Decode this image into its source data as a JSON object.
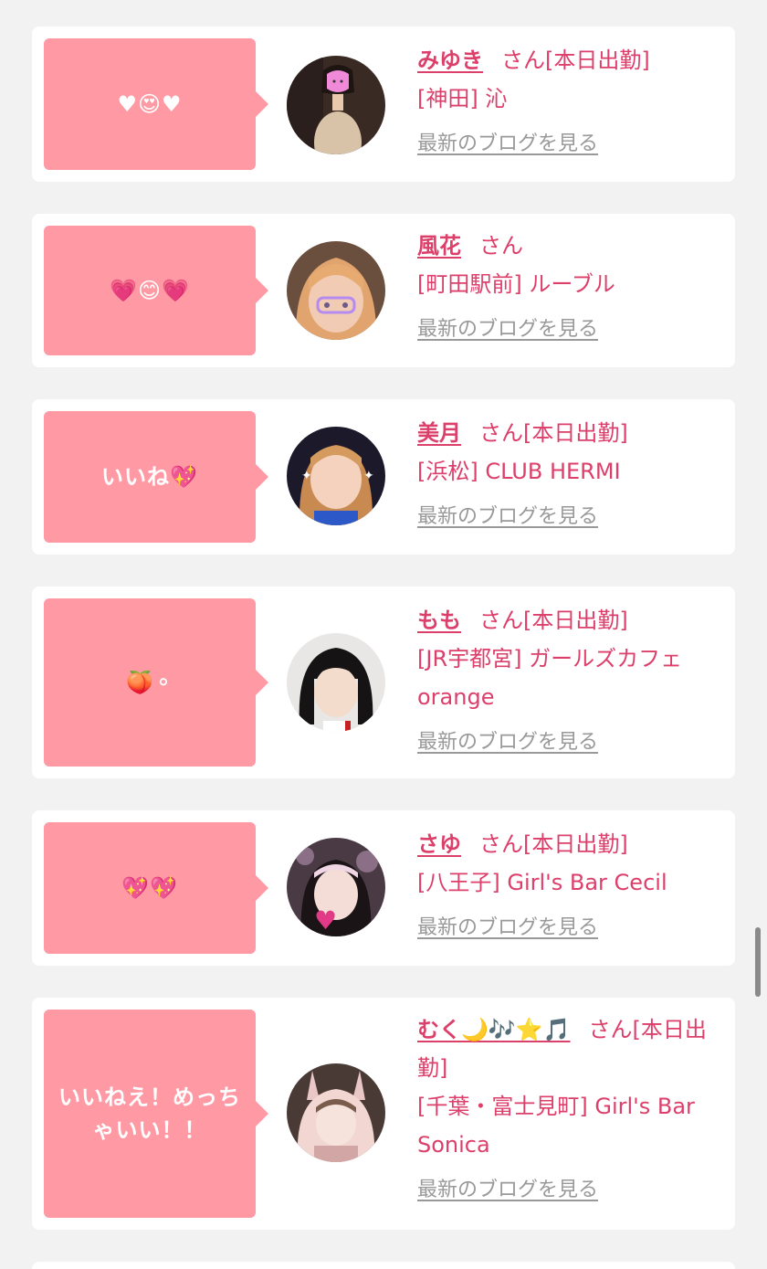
{
  "feed": {
    "items": [
      {
        "message": "♥😍♥",
        "name": "みゆき",
        "honorific": "さん",
        "status": "[本日出勤]",
        "location": "[神田] 沁",
        "blog_link": "最新のブログを見る"
      },
      {
        "message": "💗😊💗",
        "name": "風花",
        "honorific": "さん",
        "status": "",
        "location": "[町田駅前] ルーブル",
        "blog_link": "最新のブログを見る"
      },
      {
        "message": "いいね💖",
        "name": "美月",
        "honorific": "さん",
        "status": "[本日出勤]",
        "location": "[浜松] CLUB HERMI",
        "blog_link": "最新のブログを見る"
      },
      {
        "message": "🍑⚬",
        "name": "もも",
        "honorific": "さん",
        "status": "[本日出勤]",
        "location": "[JR宇都宮] ガールズカフェ orange",
        "blog_link": "最新のブログを見る"
      },
      {
        "message": "💖💖",
        "name": "さゆ",
        "honorific": "さん",
        "status": "[本日出勤]",
        "location": "[八王子] Girl's Bar Cecil",
        "blog_link": "最新のブログを見る"
      },
      {
        "message": "いいねえ！めっちゃいい！！",
        "name": "むく🌙🎶⭐🎵",
        "honorific": "さん",
        "status": "[本日出勤]",
        "location": "[千葉・富士見町] Girl's Bar Sonica",
        "blog_link": "最新のブログを見る"
      }
    ]
  },
  "colors": {
    "accent": "#dd3f6b",
    "bubble": "#ff99a4",
    "link_gray": "#999999",
    "background": "#f2f2f2"
  }
}
